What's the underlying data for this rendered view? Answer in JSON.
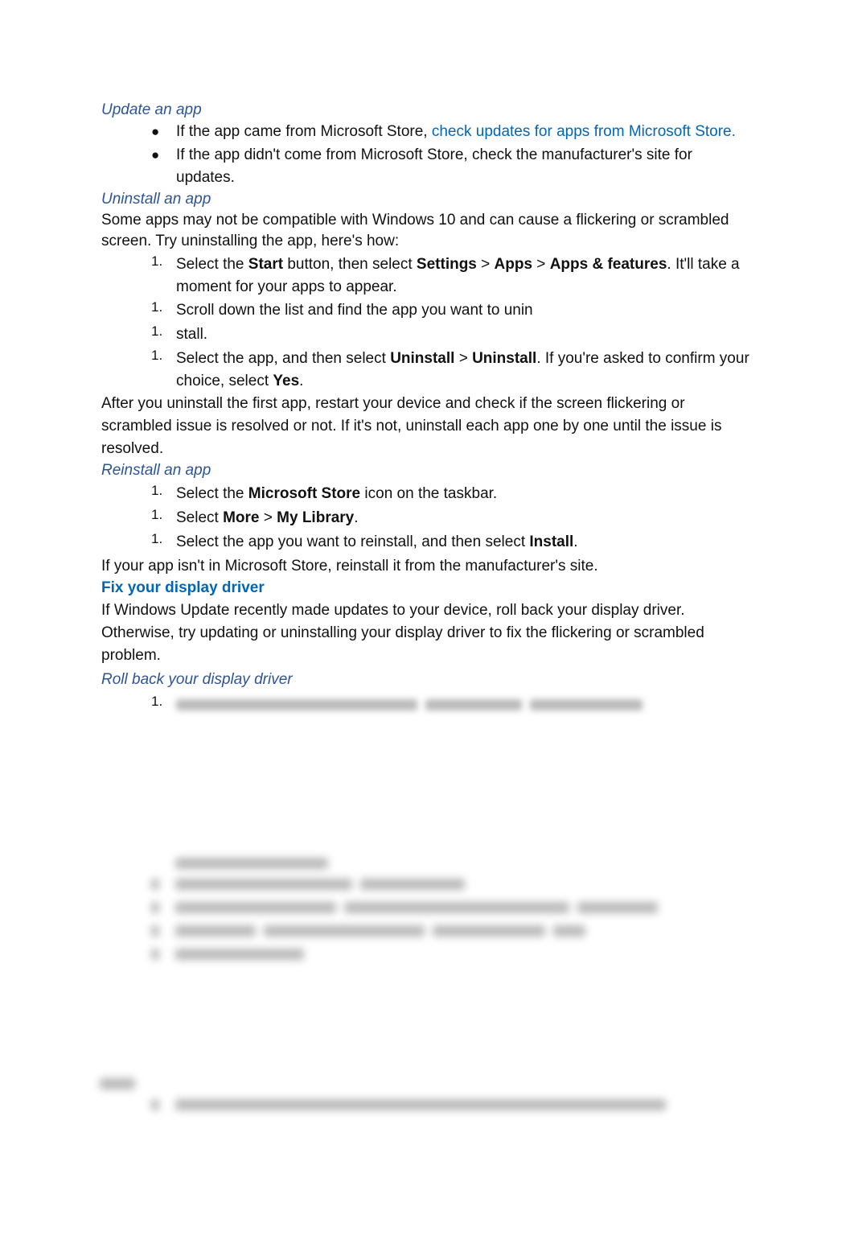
{
  "sections": {
    "update": {
      "heading": "Update an app",
      "bullet_char": "●",
      "item1_pre": "If the app came from Microsoft Store, ",
      "item1_link": "check updates for apps from Microsoft Store.",
      "item2": "If the app didn't come from Microsoft Store, check the manufacturer's site for updates."
    },
    "uninstall": {
      "heading": "Uninstall an app",
      "intro": "Some apps may not be compatible with Windows 10 and can cause a flickering or scrambled screen. Try uninstalling the app, here's how:",
      "num": "1.",
      "step1": {
        "t1": "Select the ",
        "b1": "Start",
        "t2": " button, then select ",
        "b2": "Settings",
        "t3": " > ",
        "b3": "Apps",
        "t4": " > ",
        "b4": "Apps & features",
        "t5": ". It'll take a moment for your apps to appear."
      },
      "step2": "Scroll down the list and find the app you want to unin",
      "step3": "stall.",
      "step4": {
        "t1": "Select the app, and then select ",
        "b1": "Uninstall",
        "t2": " > ",
        "b2": "Uninstall",
        "t3": ". If you're asked to confirm your choice, select ",
        "b3": "Yes",
        "t4": "."
      },
      "after": "After you uninstall the first app, restart your device and check if the screen flickering or scrambled issue is resolved or not. If it's not, uninstall each app one by one until the issue is resolved."
    },
    "reinstall": {
      "heading": "Reinstall an app",
      "num": "1.",
      "step1": {
        "t1": "Select the ",
        "b1": "Microsoft Store",
        "t2": " icon on the taskbar."
      },
      "step2": {
        "t1": "Select ",
        "b1": "More",
        "t2": " > ",
        "b2": "My Library",
        "t3": "."
      },
      "step3": {
        "t1": "Select the app you want to reinstall, and then select ",
        "b1": "Install",
        "t2": "."
      },
      "after": "If your app isn't in Microsoft Store, reinstall it from the manufacturer's site."
    },
    "driver": {
      "heading": "Fix your display driver",
      "intro": "If Windows Update recently made updates to your device, roll back your display driver. Otherwise, try updating or uninstalling your display driver to fix the flickering or scrambled problem.",
      "sub_heading": "Roll back your display driver",
      "num": "1."
    }
  }
}
